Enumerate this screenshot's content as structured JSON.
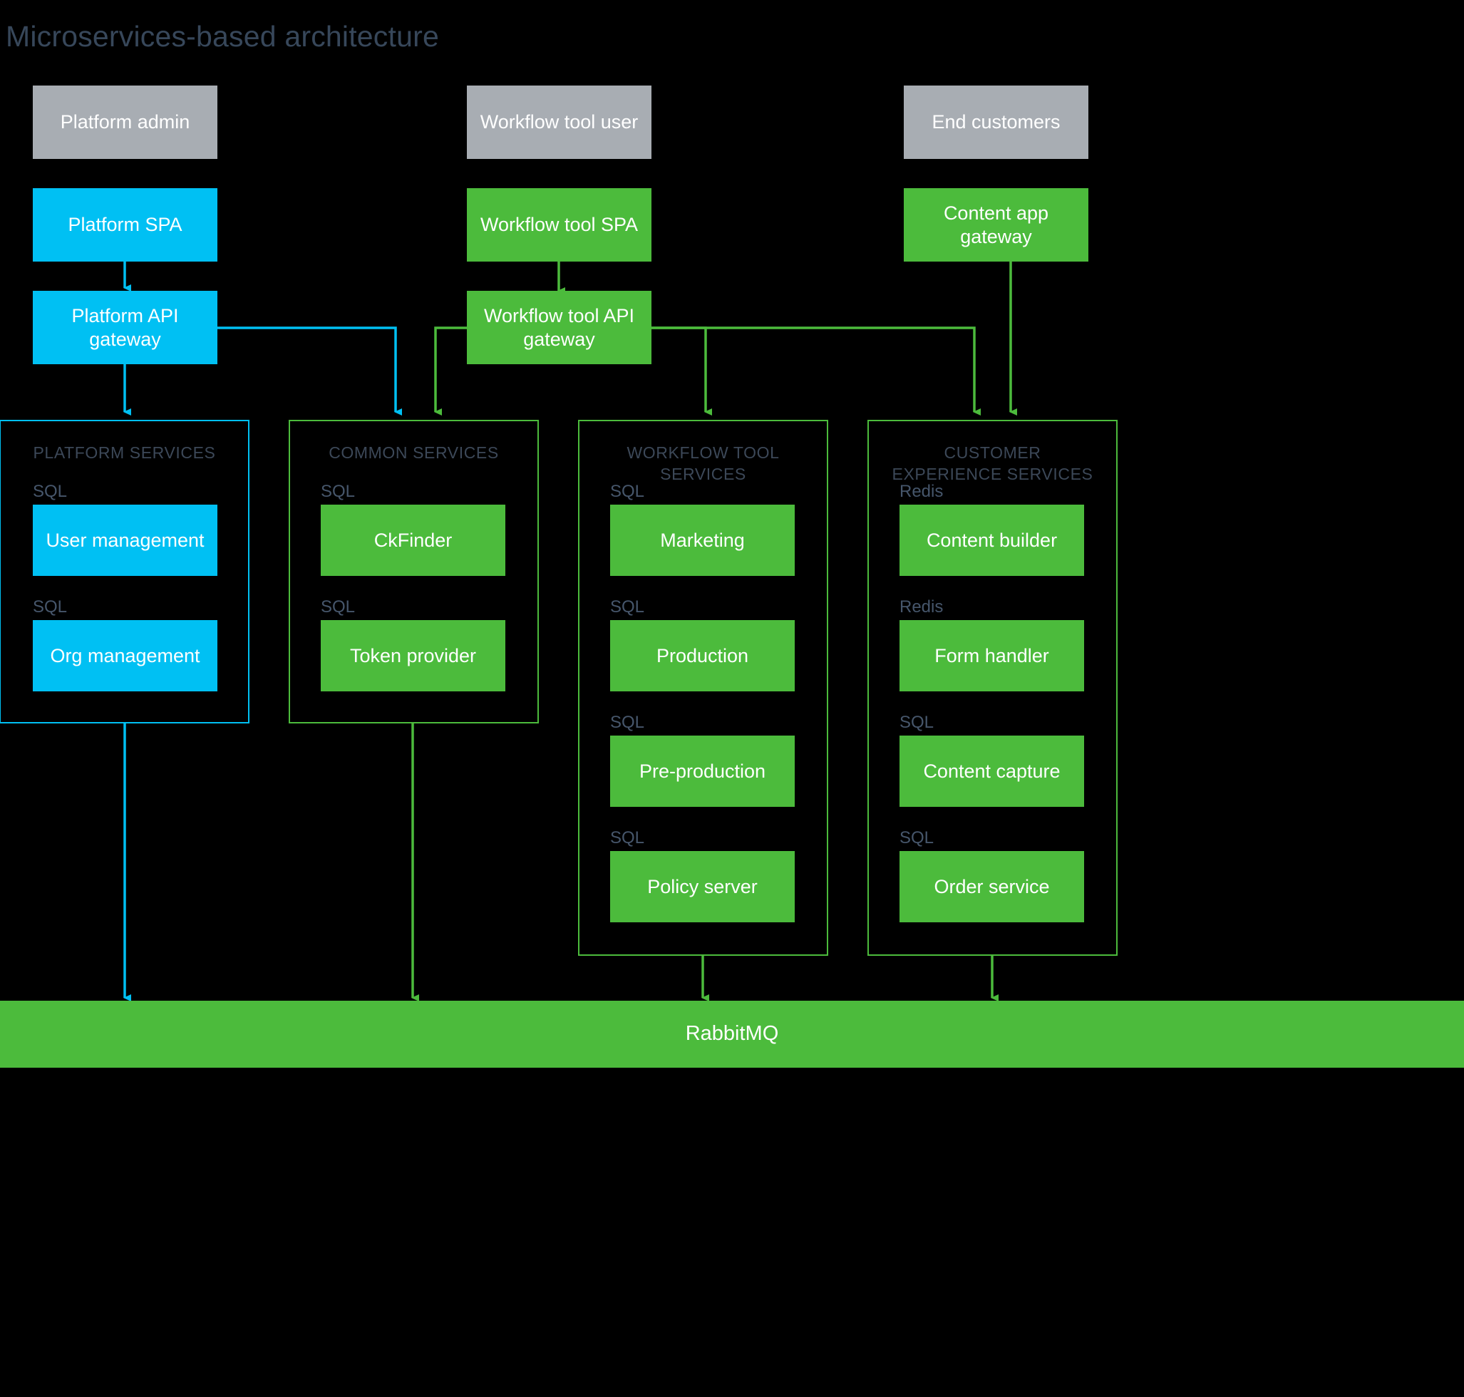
{
  "title": "Microservices-based architecture",
  "colors": {
    "background": "#000000",
    "actor_grey": "#a8adb3",
    "platform_blue": "#00c0f3",
    "service_green": "#4cbb3c",
    "label_slate": "#3c4858",
    "text_white": "#ffffff"
  },
  "actors": [
    {
      "label": "Platform admin"
    },
    {
      "label": "Workflow tool user"
    },
    {
      "label": "End customers"
    }
  ],
  "frontends": [
    {
      "label": "Platform SPA"
    },
    {
      "label": "Workflow tool SPA"
    },
    {
      "label": "Content app\ngateway"
    }
  ],
  "gateways": [
    {
      "label": "Platform API\ngateway"
    },
    {
      "label": "Workflow tool API\ngateway"
    }
  ],
  "groups": [
    {
      "title": "PLATFORM SERVICES",
      "accent": "#00c0f3",
      "services": [
        {
          "store": "SQL",
          "label": "User management"
        },
        {
          "store": "SQL",
          "label": "Org management"
        }
      ]
    },
    {
      "title": "COMMON SERVICES",
      "accent": "#4cbb3c",
      "services": [
        {
          "store": "SQL",
          "label": "CkFinder"
        },
        {
          "store": "SQL",
          "label": "Token provider"
        }
      ]
    },
    {
      "title": "WORKFLOW TOOL\nSERVICES",
      "accent": "#4cbb3c",
      "services": [
        {
          "store": "SQL",
          "label": "Marketing"
        },
        {
          "store": "SQL",
          "label": "Production"
        },
        {
          "store": "SQL",
          "label": "Pre-production"
        },
        {
          "store": "SQL",
          "label": "Policy server"
        }
      ]
    },
    {
      "title": "CUSTOMER\nEXPERIENCE SERVICES",
      "accent": "#4cbb3c",
      "services": [
        {
          "store": "Redis",
          "label": "Content builder"
        },
        {
          "store": "Redis",
          "label": "Form handler"
        },
        {
          "store": "SQL",
          "label": "Content capture"
        },
        {
          "store": "SQL",
          "label": "Order service"
        }
      ]
    }
  ],
  "message_bus": {
    "label": "RabbitMQ"
  }
}
